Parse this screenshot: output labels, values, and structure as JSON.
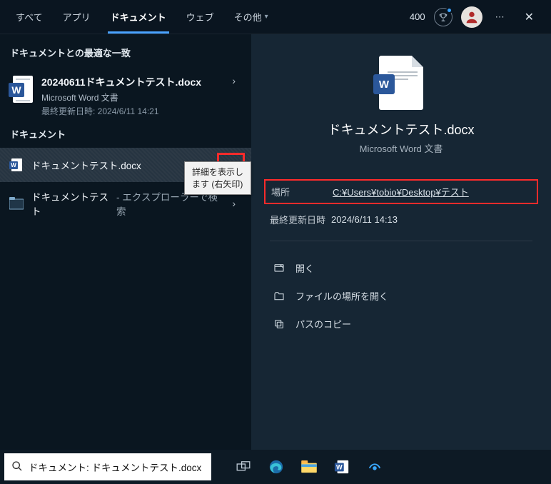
{
  "topbar": {
    "tabs": {
      "all": "すべて",
      "apps": "アプリ",
      "documents": "ドキュメント",
      "web": "ウェブ",
      "more": "その他"
    },
    "points": "400"
  },
  "left": {
    "best_match_heading": "ドキュメントとの最適な一致",
    "best": {
      "title": "20240611ドキュメントテスト.docx",
      "subtitle": "Microsoft Word 文書",
      "modified": "最終更新日時: 2024/6/11 14:21"
    },
    "docs_heading": "ドキュメント",
    "doc1": {
      "title": "ドキュメントテスト.docx"
    },
    "explorer_prefix": "ドキュメントテスト",
    "explorer_suffix": " - エクスプローラーで検索",
    "tooltip": "詳細を表示します (右矢印)"
  },
  "preview": {
    "title": "ドキュメントテスト.docx",
    "subtitle": "Microsoft Word 文書",
    "location_label": "場所",
    "location_value": "C:¥Users¥tobio¥Desktop¥テスト",
    "modified_label": "最終更新日時",
    "modified_value": "2024/6/11 14:13",
    "actions": {
      "open": "開く",
      "open_location": "ファイルの場所を開く",
      "copy_path": "パスのコピー"
    }
  },
  "search": {
    "value": "ドキュメント: ドキュメントテスト.docx"
  }
}
